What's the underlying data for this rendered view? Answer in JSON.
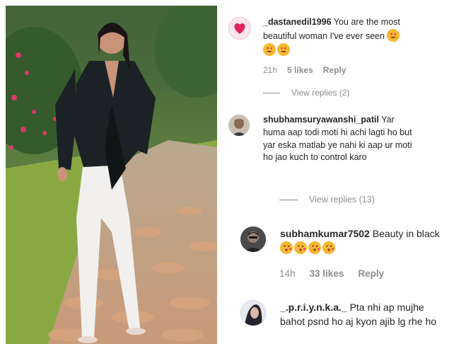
{
  "comments": [
    {
      "username": "_dastanedil1996",
      "text": "You are the most beautiful woman I've ever seen",
      "emojis": [
        "heart-eyes",
        "heart-eyes",
        "heart-eyes"
      ],
      "time": "21h",
      "likes": "5 likes",
      "reply": "Reply",
      "view_replies": "View replies (2)"
    },
    {
      "username": "shubhamsuryawanshi_patil",
      "text": "Yar huma aap todi moti hi achi lagti ho but yar eska matlab ye nahi ki aap ur moti ho jao kuch to control karo",
      "view_replies": "View replies (13)"
    },
    {
      "username": "subhamkumar7502",
      "text": "Beauty in black",
      "emojis": [
        "kiss",
        "kiss",
        "kiss",
        "kiss"
      ],
      "time": "14h",
      "likes": "33 likes",
      "reply": "Reply"
    },
    {
      "username": "_.p.r.i.y.n.k.a._",
      "text": "Pta nhi ap mujhe bahot psnd ho aj kyon ajib lg rhe ho"
    }
  ],
  "colors": {
    "emoji": "#f7b733",
    "heart": "#e0245e",
    "meta": "#8e8e8e"
  }
}
